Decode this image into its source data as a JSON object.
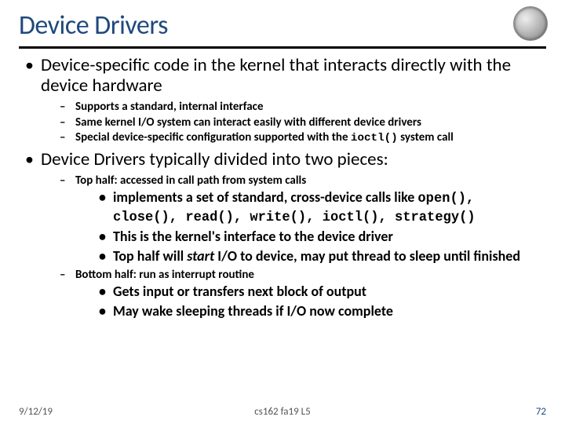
{
  "title": "Device Drivers",
  "bullets": {
    "b1": "Device-specific code in the kernel that interacts directly with the device hardware",
    "b1_1": "Supports a standard, internal interface",
    "b1_2": "Same kernel I/O system can interact easily with different device drivers",
    "b1_3_a": "Special device-specific configuration supported with the ",
    "b1_3_code": "ioctl()",
    "b1_3_b": " system call",
    "b2": "Device Drivers typically divided into two pieces:",
    "b2_1": "Top half: accessed in call path from system calls",
    "b2_1_1_a": "implements a set of standard, cross-device calls like ",
    "b2_1_1_code": "open(), close(), read(), write(), ioctl(), strategy()",
    "b2_1_2": "This is the kernel's interface to the device driver",
    "b2_1_3_a": "Top half will ",
    "b2_1_3_em": "start",
    "b2_1_3_b": " I/O to device, may put thread to sleep until finished",
    "b2_2": "Bottom half: run as interrupt routine",
    "b2_2_1": "Gets input or transfers next block of output",
    "b2_2_2": "May wake sleeping threads if I/O now complete"
  },
  "footer": {
    "date": "9/12/19",
    "course": "cs162 fa19 L5",
    "page": "72"
  }
}
